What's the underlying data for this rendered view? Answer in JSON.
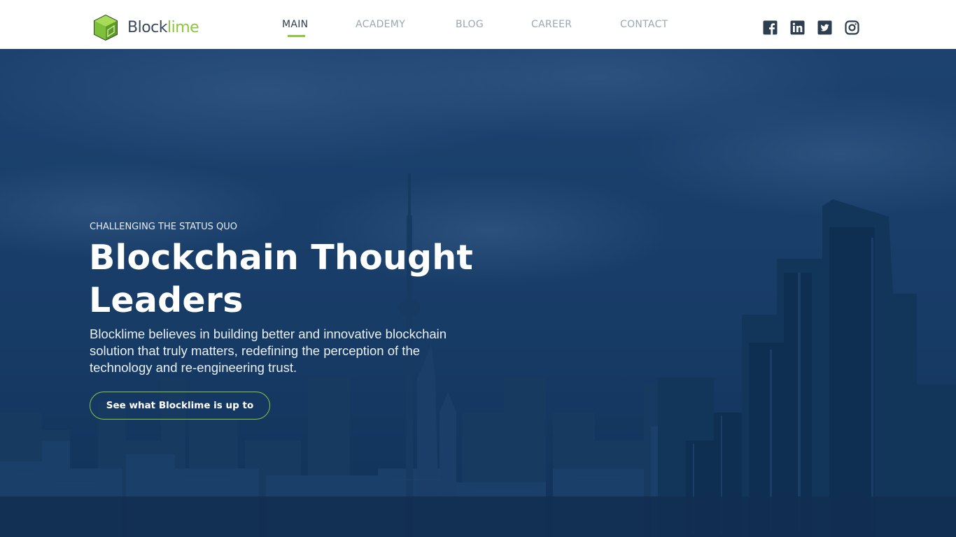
{
  "brand": {
    "name_part1": "Block",
    "name_part2": "lime"
  },
  "nav": {
    "items": [
      {
        "label": "MAIN",
        "active": true
      },
      {
        "label": "ACADEMY",
        "active": false
      },
      {
        "label": "BLOG",
        "active": false
      },
      {
        "label": "CAREER",
        "active": false
      },
      {
        "label": "CONTACT",
        "active": false
      }
    ]
  },
  "social": {
    "icons": [
      "facebook-icon",
      "linkedin-icon",
      "twitter-icon",
      "instagram-icon"
    ]
  },
  "hero": {
    "eyebrow": "CHALLENGING THE STATUS QUO",
    "headline": "Blockchain Thought Leaders",
    "description": "Blocklime believes in building better and innovative blockchain solution that truly matters, redefining the perception of the technology and re-engineering trust.",
    "cta_label": "See what Blocklime is up to"
  },
  "colors": {
    "accent": "#8cc63f",
    "hero_overlay": "#143a63",
    "nav_text": "#9aa7b4",
    "nav_active": "#2c3e50",
    "icon": "#2c3e50"
  }
}
